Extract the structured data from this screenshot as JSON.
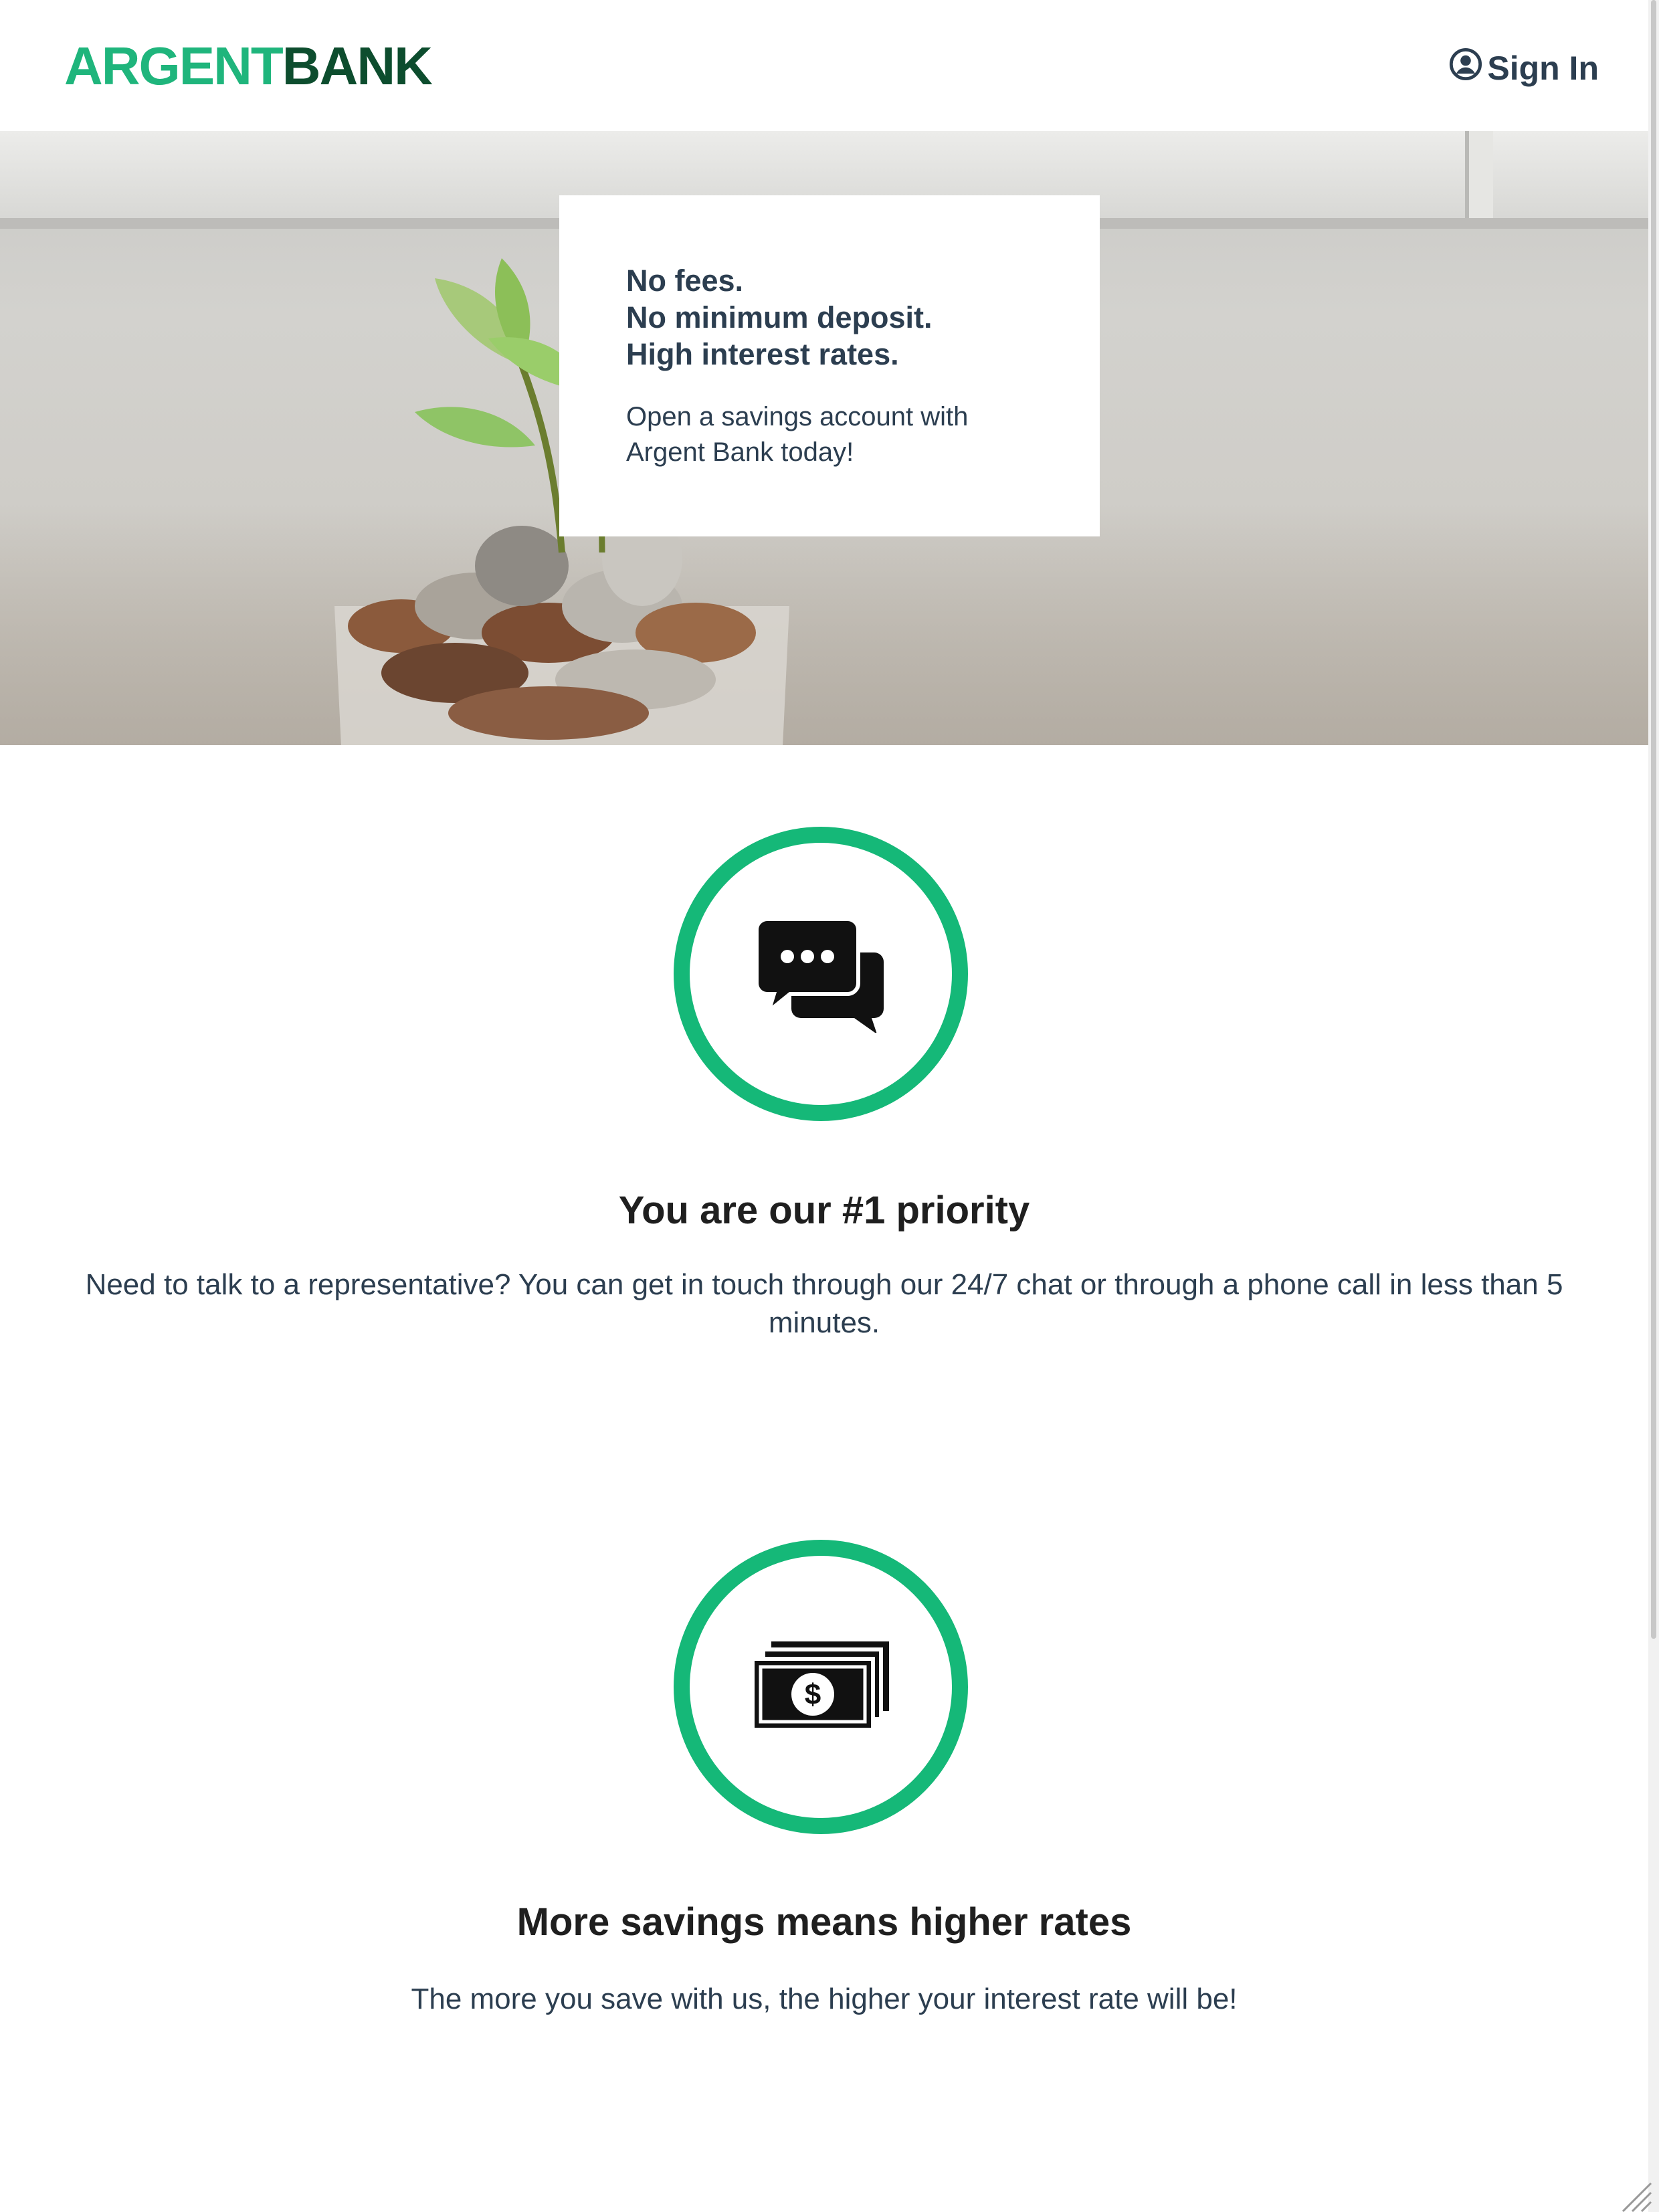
{
  "colors": {
    "brand_green": "#1fb57c",
    "brand_dark": "#0d4d2e",
    "accent": "#15b878",
    "text": "#2c3e50"
  },
  "header": {
    "logo_part1": "ARGENT",
    "logo_part2": "BANK",
    "signin_label": "Sign In",
    "signin_icon": "user-circle-icon"
  },
  "hero": {
    "lines": [
      "No fees.",
      "No minimum deposit.",
      "High interest rates."
    ],
    "subtitle": "Open a savings account with Argent Bank today!"
  },
  "features": [
    {
      "icon": "chat-icon",
      "title": "You are our #1 priority",
      "text": "Need to talk to a representative? You can get in touch through our 24/7 chat or through a phone call in less than 5 minutes."
    },
    {
      "icon": "money-icon",
      "title": "More savings means higher rates",
      "text": "The more you save with us, the higher your interest rate will be!"
    }
  ]
}
